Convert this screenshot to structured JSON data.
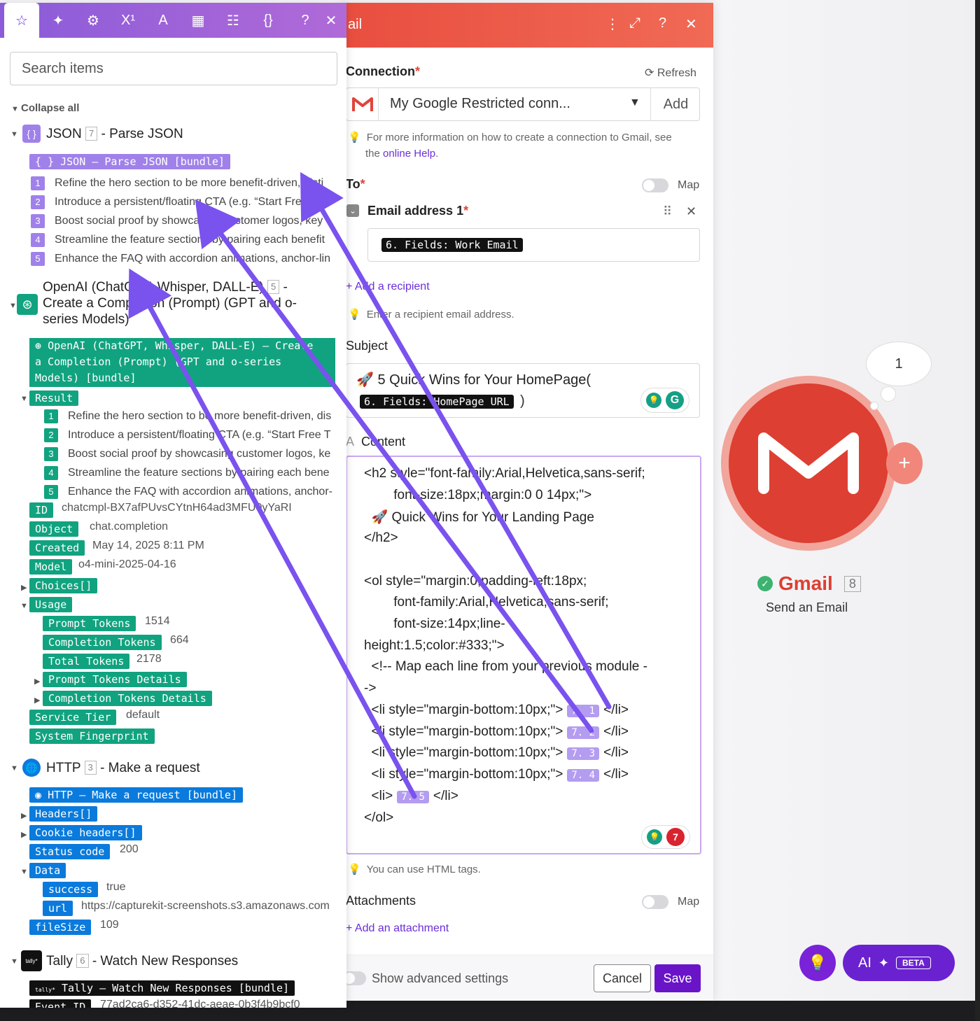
{
  "panel": {
    "search_placeholder": "Search items",
    "collapse_all": "Collapse all",
    "json_group": {
      "name": "JSON",
      "id": "7",
      "action": "- Parse JSON",
      "bundle": "JSON – Parse JSON [bundle]",
      "items": [
        {
          "n": "1",
          "text": "Refine the hero section to be more benefit-driven, disti"
        },
        {
          "n": "2",
          "text": "Introduce a persistent/floating CTA (e.g. “Start Free Tria"
        },
        {
          "n": "3",
          "text": "Boost social proof by showcasing customer logos, key"
        },
        {
          "n": "4",
          "text": "Streamline the feature sections by pairing each benefit"
        },
        {
          "n": "5",
          "text": "Enhance the FAQ with accordion animations, anchor-lin"
        }
      ]
    },
    "openai_group": {
      "title_line1": "OpenAI (ChatGPT, Whisper, DALL-E)",
      "id": "5",
      "title_line2": "Create a Completion (Prompt) (GPT and o-",
      "title_line3": "series Models)",
      "bundle_line1": "OpenAI (ChatGPT, Whisper, DALL-E) – Create",
      "bundle_line2": "a Completion (Prompt) (GPT and o-series",
      "bundle_line3": "Models) [bundle]",
      "result": "Result",
      "items": [
        {
          "n": "1",
          "text": "Refine the hero section to be more benefit-driven, dis"
        },
        {
          "n": "2",
          "text": "Introduce a persistent/floating CTA (e.g. “Start Free T"
        },
        {
          "n": "3",
          "text": "Boost social proof by showcasing customer logos, ke"
        },
        {
          "n": "4",
          "text": "Streamline the feature sections by pairing each bene"
        },
        {
          "n": "5",
          "text": "Enhance the FAQ with accordion animations, anchor-"
        }
      ],
      "fields": [
        {
          "k": "ID",
          "v": "chatcmpl-BX7afPUvsCYtnH64ad3MFU0yYaRI"
        },
        {
          "k": "Object",
          "v": "chat.completion"
        },
        {
          "k": "Created",
          "v": "May 14, 2025 8:11 PM"
        },
        {
          "k": "Model",
          "v": "o4-mini-2025-04-16"
        }
      ],
      "choices": "Choices[]",
      "usage": "Usage",
      "usage_fields": [
        {
          "k": "Prompt Tokens",
          "v": "1514"
        },
        {
          "k": "Completion Tokens",
          "v": "664"
        },
        {
          "k": "Total Tokens",
          "v": "2178"
        }
      ],
      "prompt_details": "Prompt Tokens Details",
      "completion_details": "Completion Tokens Details",
      "service_tier": "Service Tier",
      "service_tier_val": "default",
      "fingerprint": "System Fingerprint"
    },
    "http_group": {
      "name": "HTTP",
      "id": "3",
      "action": "- Make a request",
      "bundle": "HTTP – Make a request [bundle]",
      "headers": "Headers[]",
      "cookie": "Cookie headers[]",
      "status": "Status code",
      "status_val": "200",
      "data": "Data",
      "success": "success",
      "success_val": "true",
      "url": "url",
      "url_val": "https://capturekit-screenshots.s3.amazonaws.com",
      "filesize": "fileSize",
      "filesize_val": "109"
    },
    "tally_group": {
      "name": "Tally",
      "id": "6",
      "action": "- Watch New Responses",
      "logo": "tally*",
      "bundle": "Tally – Watch New Responses [bundle]",
      "event": "Event ID",
      "event_val": "77ad2ca6-d352-41dc-aeae-0b3f4b9bcf0"
    }
  },
  "email": {
    "title": "ail",
    "connection_label": "Connection",
    "refresh": "Refresh",
    "connection_value": "My Google Restricted conn...",
    "add": "Add",
    "conn_hint_1": "For more information on how to create a connection to Gmail, see",
    "conn_hint_2": "the ",
    "conn_hint_link": "online Help",
    "to_label": "To",
    "map": "Map",
    "email_addr_label": "Email address 1",
    "email_pill": "6. Fields: Work Email",
    "add_recipient": "+ Add a recipient",
    "recipient_hint": "Enter a recipient email address.",
    "subject_label": "Subject",
    "subject_text": "🚀 5 Quick Wins for Your HomePage(",
    "subject_pill": "6. Fields: HomePage URL",
    "subject_close": ")",
    "content_label": "Content",
    "content_prefix": "A",
    "code_lines": [
      "<h2 style=\"font-family:Arial,Helvetica,sans-serif;",
      "        font-size:18px;margin:0 0 14px;\">",
      "  🚀 Quick Wins for Your Landing Page",
      "</h2>",
      "",
      "<ol style=\"margin:0;padding-left:18px;",
      "        font-family:Arial,Helvetica,sans-serif;",
      "        font-size:14px;line-",
      "height:1.5;color:#333;\">",
      "  <!-- Map each line from your previous module -",
      "->"
    ],
    "li_lines": [
      {
        "pre": "  <li style=\"margin-bottom:10px;\">",
        "pill": "7. 1",
        "post": "</li>"
      },
      {
        "pre": "  <li style=\"margin-bottom:10px;\">",
        "pill": "7. 2",
        "post": "</li>"
      },
      {
        "pre": "  <li style=\"margin-bottom:10px;\">",
        "pill": "7. 3",
        "post": "</li>"
      },
      {
        "pre": "  <li style=\"margin-bottom:10px;\">",
        "pill": "7. 4",
        "post": "</li>"
      },
      {
        "pre": "  <li>",
        "pill": "7. 5",
        "post": "</li>"
      }
    ],
    "code_end": "</ol>",
    "grammarly_count": "7",
    "html_hint": "You can use HTML tags.",
    "attachments_label": "Attachments",
    "add_attachment": "+ Add an attachment",
    "advanced": "Show advanced settings",
    "cancel": "Cancel",
    "save": "Save"
  },
  "module": {
    "name": "Gmail",
    "id": "8",
    "action": "Send an Email",
    "bubble": "1"
  },
  "ai_button": {
    "label": "AI",
    "beta": "BETA"
  },
  "colors": {
    "purple": "#6b2fd8",
    "gmail_red": "#dd3f32",
    "openai_green": "#11a37f",
    "http_blue": "#0a7bdc"
  }
}
